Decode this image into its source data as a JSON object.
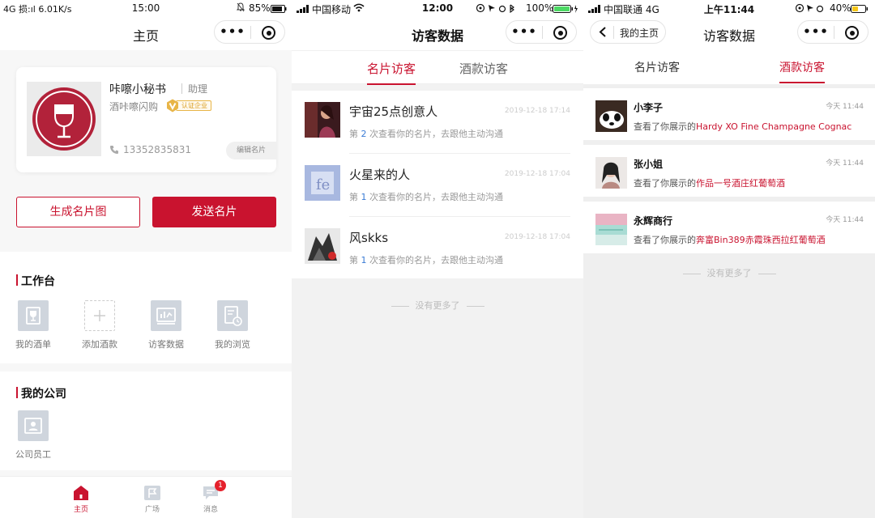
{
  "colors": {
    "accent": "#c9132f",
    "link_blue": "#3a7bd5",
    "badge_red": "#e5212c",
    "verified_gold": "#e8b547"
  },
  "screen1": {
    "status": {
      "left": "4G 损:ıl 6.01K/s",
      "time": "15:00",
      "battery": "85%"
    },
    "nav_title": "主页",
    "card": {
      "name": "咔嚓小秘书",
      "role": "助理",
      "company": "酒咔嚓闪购",
      "verified_label": "认证企业",
      "phone": "13352835831",
      "edit_label": "编辑名片"
    },
    "buttons": {
      "generate": "生成名片图",
      "send": "发送名片"
    },
    "workbench": {
      "title": "工作台",
      "items": [
        {
          "label": "我的酒单",
          "icon": "wine-list-icon"
        },
        {
          "label": "添加酒款",
          "icon": "add-icon"
        },
        {
          "label": "访客数据",
          "icon": "chart-icon"
        },
        {
          "label": "我的浏览",
          "icon": "history-icon"
        }
      ]
    },
    "company_section": {
      "title": "我的公司",
      "items": [
        {
          "label": "公司员工",
          "icon": "staff-icon"
        }
      ]
    },
    "tabbar": [
      {
        "label": "主页",
        "icon": "home-icon",
        "active": true
      },
      {
        "label": "广场",
        "icon": "square-flag-icon",
        "active": false
      },
      {
        "label": "消息",
        "icon": "message-icon",
        "active": false,
        "badge": "1"
      }
    ]
  },
  "screen2": {
    "status": {
      "carrier": "中国移动",
      "time": "12:00",
      "battery": "100%"
    },
    "nav_title": "访客数据",
    "tabs": [
      {
        "label": "名片访客",
        "active": true
      },
      {
        "label": "酒款访客",
        "active": false
      }
    ],
    "visitors": [
      {
        "name": "宇宙25点创意人",
        "time": "2019-12-18 17:14",
        "prefix": "第",
        "count": "2",
        "suffix": "次查看你的名片，去跟他主动沟通"
      },
      {
        "name": "火星来的人",
        "time": "2019-12-18 17:04",
        "prefix": "第",
        "count": "1",
        "suffix": "次查看你的名片，去跟他主动沟通"
      },
      {
        "name": "风skks",
        "time": "2019-12-18 17:04",
        "prefix": "第",
        "count": "1",
        "suffix": "次查看你的名片，去跟他主动沟通"
      }
    ],
    "no_more": "没有更多了"
  },
  "screen3": {
    "status": {
      "carrier": "中国联通 4G",
      "time": "上午11:44",
      "battery": "40%"
    },
    "back_label": "我的主页",
    "nav_title": "访客数据",
    "tabs": [
      {
        "label": "名片访客",
        "active": false
      },
      {
        "label": "酒款访客",
        "active": true
      }
    ],
    "visitors": [
      {
        "name": "小李子",
        "time": "今天 11:44",
        "prefix": "查看了你展示的",
        "wine": "Hardy XO Fine Champagne Cognac"
      },
      {
        "name": "张小姐",
        "time": "今天 11:44",
        "prefix": "查看了你展示的",
        "wine": "作品一号酒庄红葡萄酒"
      },
      {
        "name": "永辉商行",
        "time": "今天 11:44",
        "prefix": "查看了你展示的",
        "wine": "奔富Bin389赤霞珠西拉红葡萄酒"
      }
    ],
    "no_more": "没有更多了"
  }
}
